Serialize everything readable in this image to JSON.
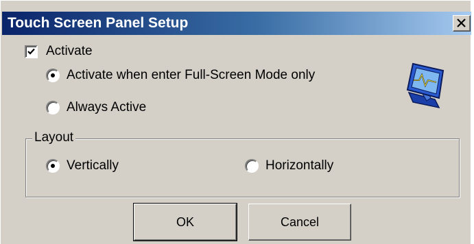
{
  "window": {
    "title": "Touch Screen Panel Setup",
    "close_glyph": "close-icon"
  },
  "activate": {
    "label": "Activate",
    "checked": true,
    "options": [
      {
        "label": "Activate when enter Full-Screen Mode only",
        "selected": true
      },
      {
        "label": "Always Active",
        "selected": false
      }
    ]
  },
  "layout": {
    "legend": "Layout",
    "options": [
      {
        "label": "Vertically",
        "selected": true
      },
      {
        "label": "Horizontally",
        "selected": false
      }
    ]
  },
  "buttons": {
    "ok": "OK",
    "cancel": "Cancel"
  },
  "icons": {
    "device": "touch-monitor-icon"
  },
  "colors": {
    "title_start": "#0a246a",
    "title_end": "#a6caf0",
    "face": "#d4d0c8"
  }
}
